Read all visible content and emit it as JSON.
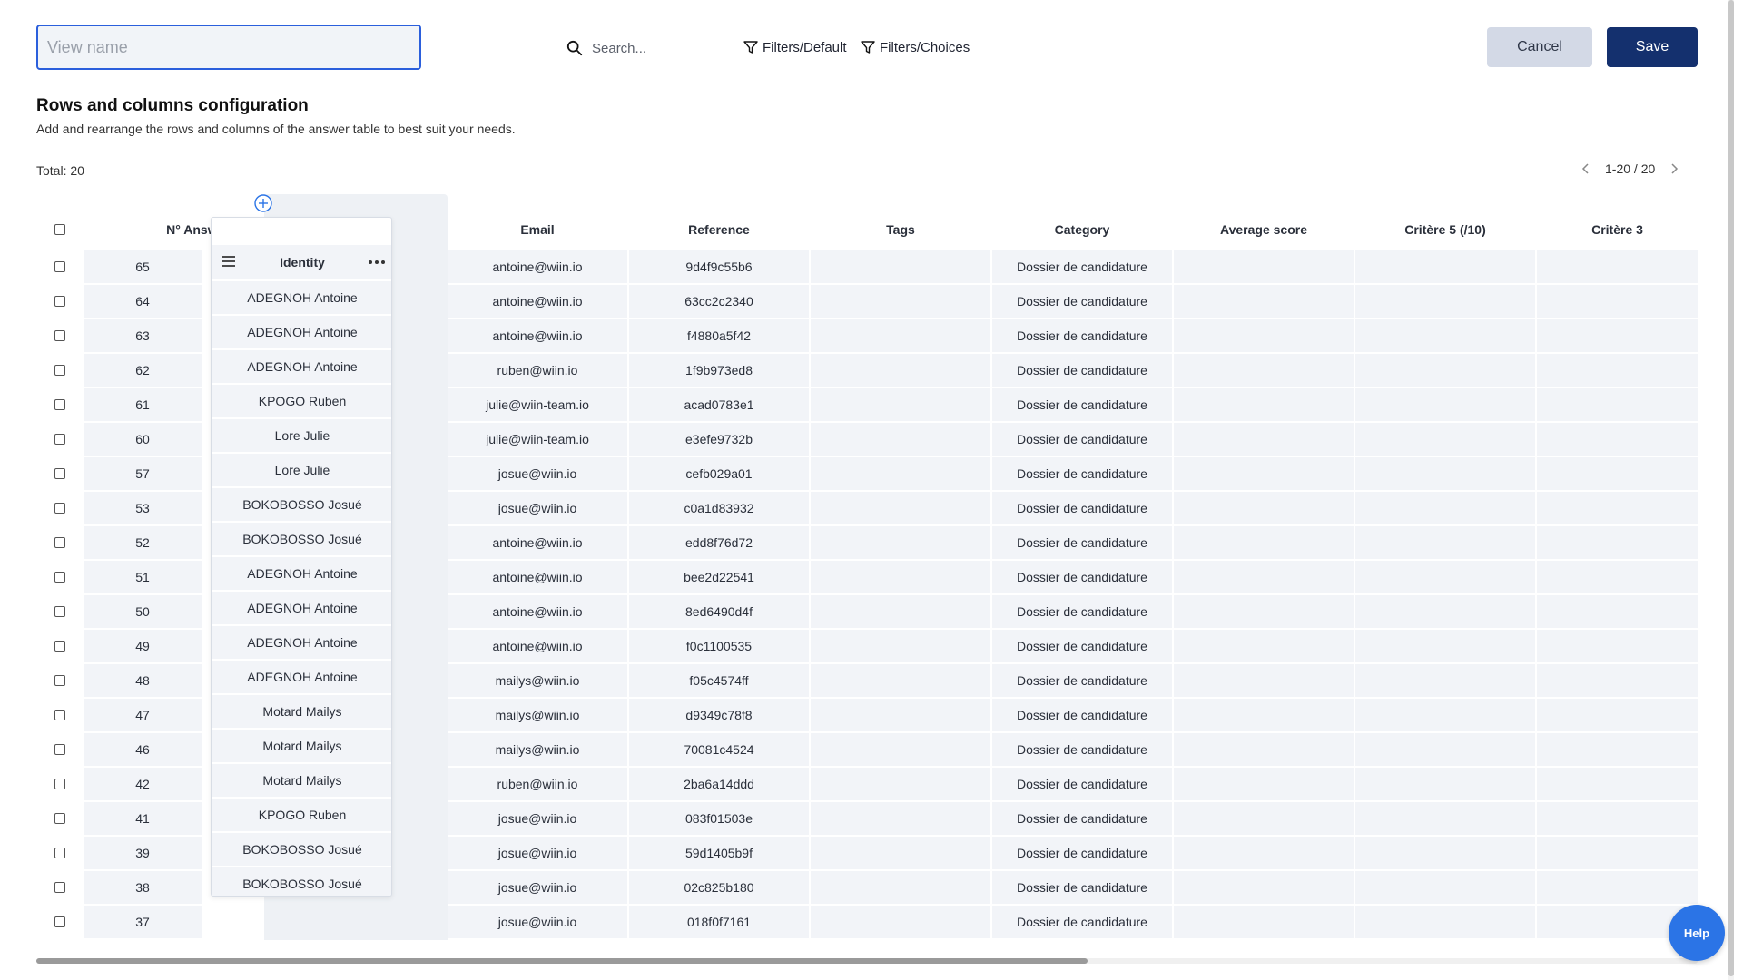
{
  "toolbar": {
    "view_name_placeholder": "View name",
    "view_name_value": "",
    "search_placeholder": "Search...",
    "filter_default_label": "Filters/Default",
    "filter_choices_label": "Filters/Choices",
    "cancel_label": "Cancel",
    "save_label": "Save"
  },
  "config": {
    "title": "Rows and columns configuration",
    "subtitle": "Add and rearrange the rows and columns of the answer table to best suit your needs.",
    "total": "Total: 20",
    "pager": "1-20 / 20"
  },
  "table": {
    "headers": {
      "answer": "N° Answer",
      "identity": "Identity",
      "email": "Email",
      "reference": "Reference",
      "tags": "Tags",
      "category": "Category",
      "average": "Average score",
      "crit5": "Critère 5 (/10)",
      "crit3": "Critère 3"
    },
    "rows": [
      {
        "answer": "65",
        "identity": "",
        "email": "antoine@wiin.io",
        "reference": "9d4f9c55b6",
        "tags": "",
        "category": "Dossier de candidature"
      },
      {
        "answer": "64",
        "identity": "ADEGNOH Antoine",
        "email": "antoine@wiin.io",
        "reference": "63cc2c2340",
        "tags": "",
        "category": "Dossier de candidature"
      },
      {
        "answer": "63",
        "identity": "ADEGNOH Antoine",
        "email": "antoine@wiin.io",
        "reference": "f4880a5f42",
        "tags": "",
        "category": "Dossier de candidature"
      },
      {
        "answer": "62",
        "identity": "ADEGNOH Antoine",
        "email": "ruben@wiin.io",
        "reference": "1f9b973ed8",
        "tags": "",
        "category": "Dossier de candidature"
      },
      {
        "answer": "61",
        "identity": "KPOGO Ruben",
        "email": "julie@wiin-team.io",
        "reference": "acad0783e1",
        "tags": "",
        "category": "Dossier de candidature"
      },
      {
        "answer": "60",
        "identity": "Lore Julie",
        "email": "julie@wiin-team.io",
        "reference": "e3efe9732b",
        "tags": "",
        "category": "Dossier de candidature"
      },
      {
        "answer": "57",
        "identity": "Lore Julie",
        "email": "josue@wiin.io",
        "reference": "cefb029a01",
        "tags": "",
        "category": "Dossier de candidature"
      },
      {
        "answer": "53",
        "identity": "BOKOBOSSO Josué",
        "email": "josue@wiin.io",
        "reference": "c0a1d83932",
        "tags": "",
        "category": "Dossier de candidature"
      },
      {
        "answer": "52",
        "identity": "BOKOBOSSO Josué",
        "email": "antoine@wiin.io",
        "reference": "edd8f76d72",
        "tags": "",
        "category": "Dossier de candidature"
      },
      {
        "answer": "51",
        "identity": "ADEGNOH Antoine",
        "email": "antoine@wiin.io",
        "reference": "bee2d22541",
        "tags": "",
        "category": "Dossier de candidature"
      },
      {
        "answer": "50",
        "identity": "ADEGNOH Antoine",
        "email": "antoine@wiin.io",
        "reference": "8ed6490d4f",
        "tags": "",
        "category": "Dossier de candidature"
      },
      {
        "answer": "49",
        "identity": "ADEGNOH Antoine",
        "email": "antoine@wiin.io",
        "reference": "f0c1100535",
        "tags": "",
        "category": "Dossier de candidature"
      },
      {
        "answer": "48",
        "identity": "ADEGNOH Antoine",
        "email": "mailys@wiin.io",
        "reference": "f05c4574ff",
        "tags": "",
        "category": "Dossier de candidature"
      },
      {
        "answer": "47",
        "identity": "Motard Mailys",
        "email": "mailys@wiin.io",
        "reference": "d9349c78f8",
        "tags": "",
        "category": "Dossier de candidature"
      },
      {
        "answer": "46",
        "identity": "Motard Mailys",
        "email": "mailys@wiin.io",
        "reference": "70081c4524",
        "tags": "",
        "category": "Dossier de candidature"
      },
      {
        "answer": "42",
        "identity": "Motard Mailys",
        "email": "ruben@wiin.io",
        "reference": "2ba6a14ddd",
        "tags": "",
        "category": "Dossier de candidature"
      },
      {
        "answer": "41",
        "identity": "KPOGO Ruben",
        "email": "josue@wiin.io",
        "reference": "083f01503e",
        "tags": "",
        "category": "Dossier de candidature"
      },
      {
        "answer": "39",
        "identity": "BOKOBOSSO Josué",
        "email": "josue@wiin.io",
        "reference": "59d1405b9f",
        "tags": "",
        "category": "Dossier de candidature"
      },
      {
        "answer": "38",
        "identity": "BOKOBOSSO Josué",
        "email": "josue@wiin.io",
        "reference": "02c825b180",
        "tags": "",
        "category": "Dossier de candidature"
      },
      {
        "answer": "37",
        "identity": "",
        "email": "josue@wiin.io",
        "reference": "018f0f7161",
        "tags": "",
        "category": "Dossier de candidature"
      }
    ]
  },
  "help": {
    "label": "Help"
  },
  "colors": {
    "accent": "#2b5fdc",
    "primary": "#14306e",
    "cell_bg": "#f2f4f8",
    "help": "#2b74e6"
  },
  "icons": {
    "search": "search-icon",
    "filter": "filter-icon",
    "add": "plus-circle-icon",
    "drag": "drag-handle-icon",
    "menu": "more-horizontal-icon",
    "prev": "chevron-left-icon",
    "next": "chevron-right-icon"
  }
}
